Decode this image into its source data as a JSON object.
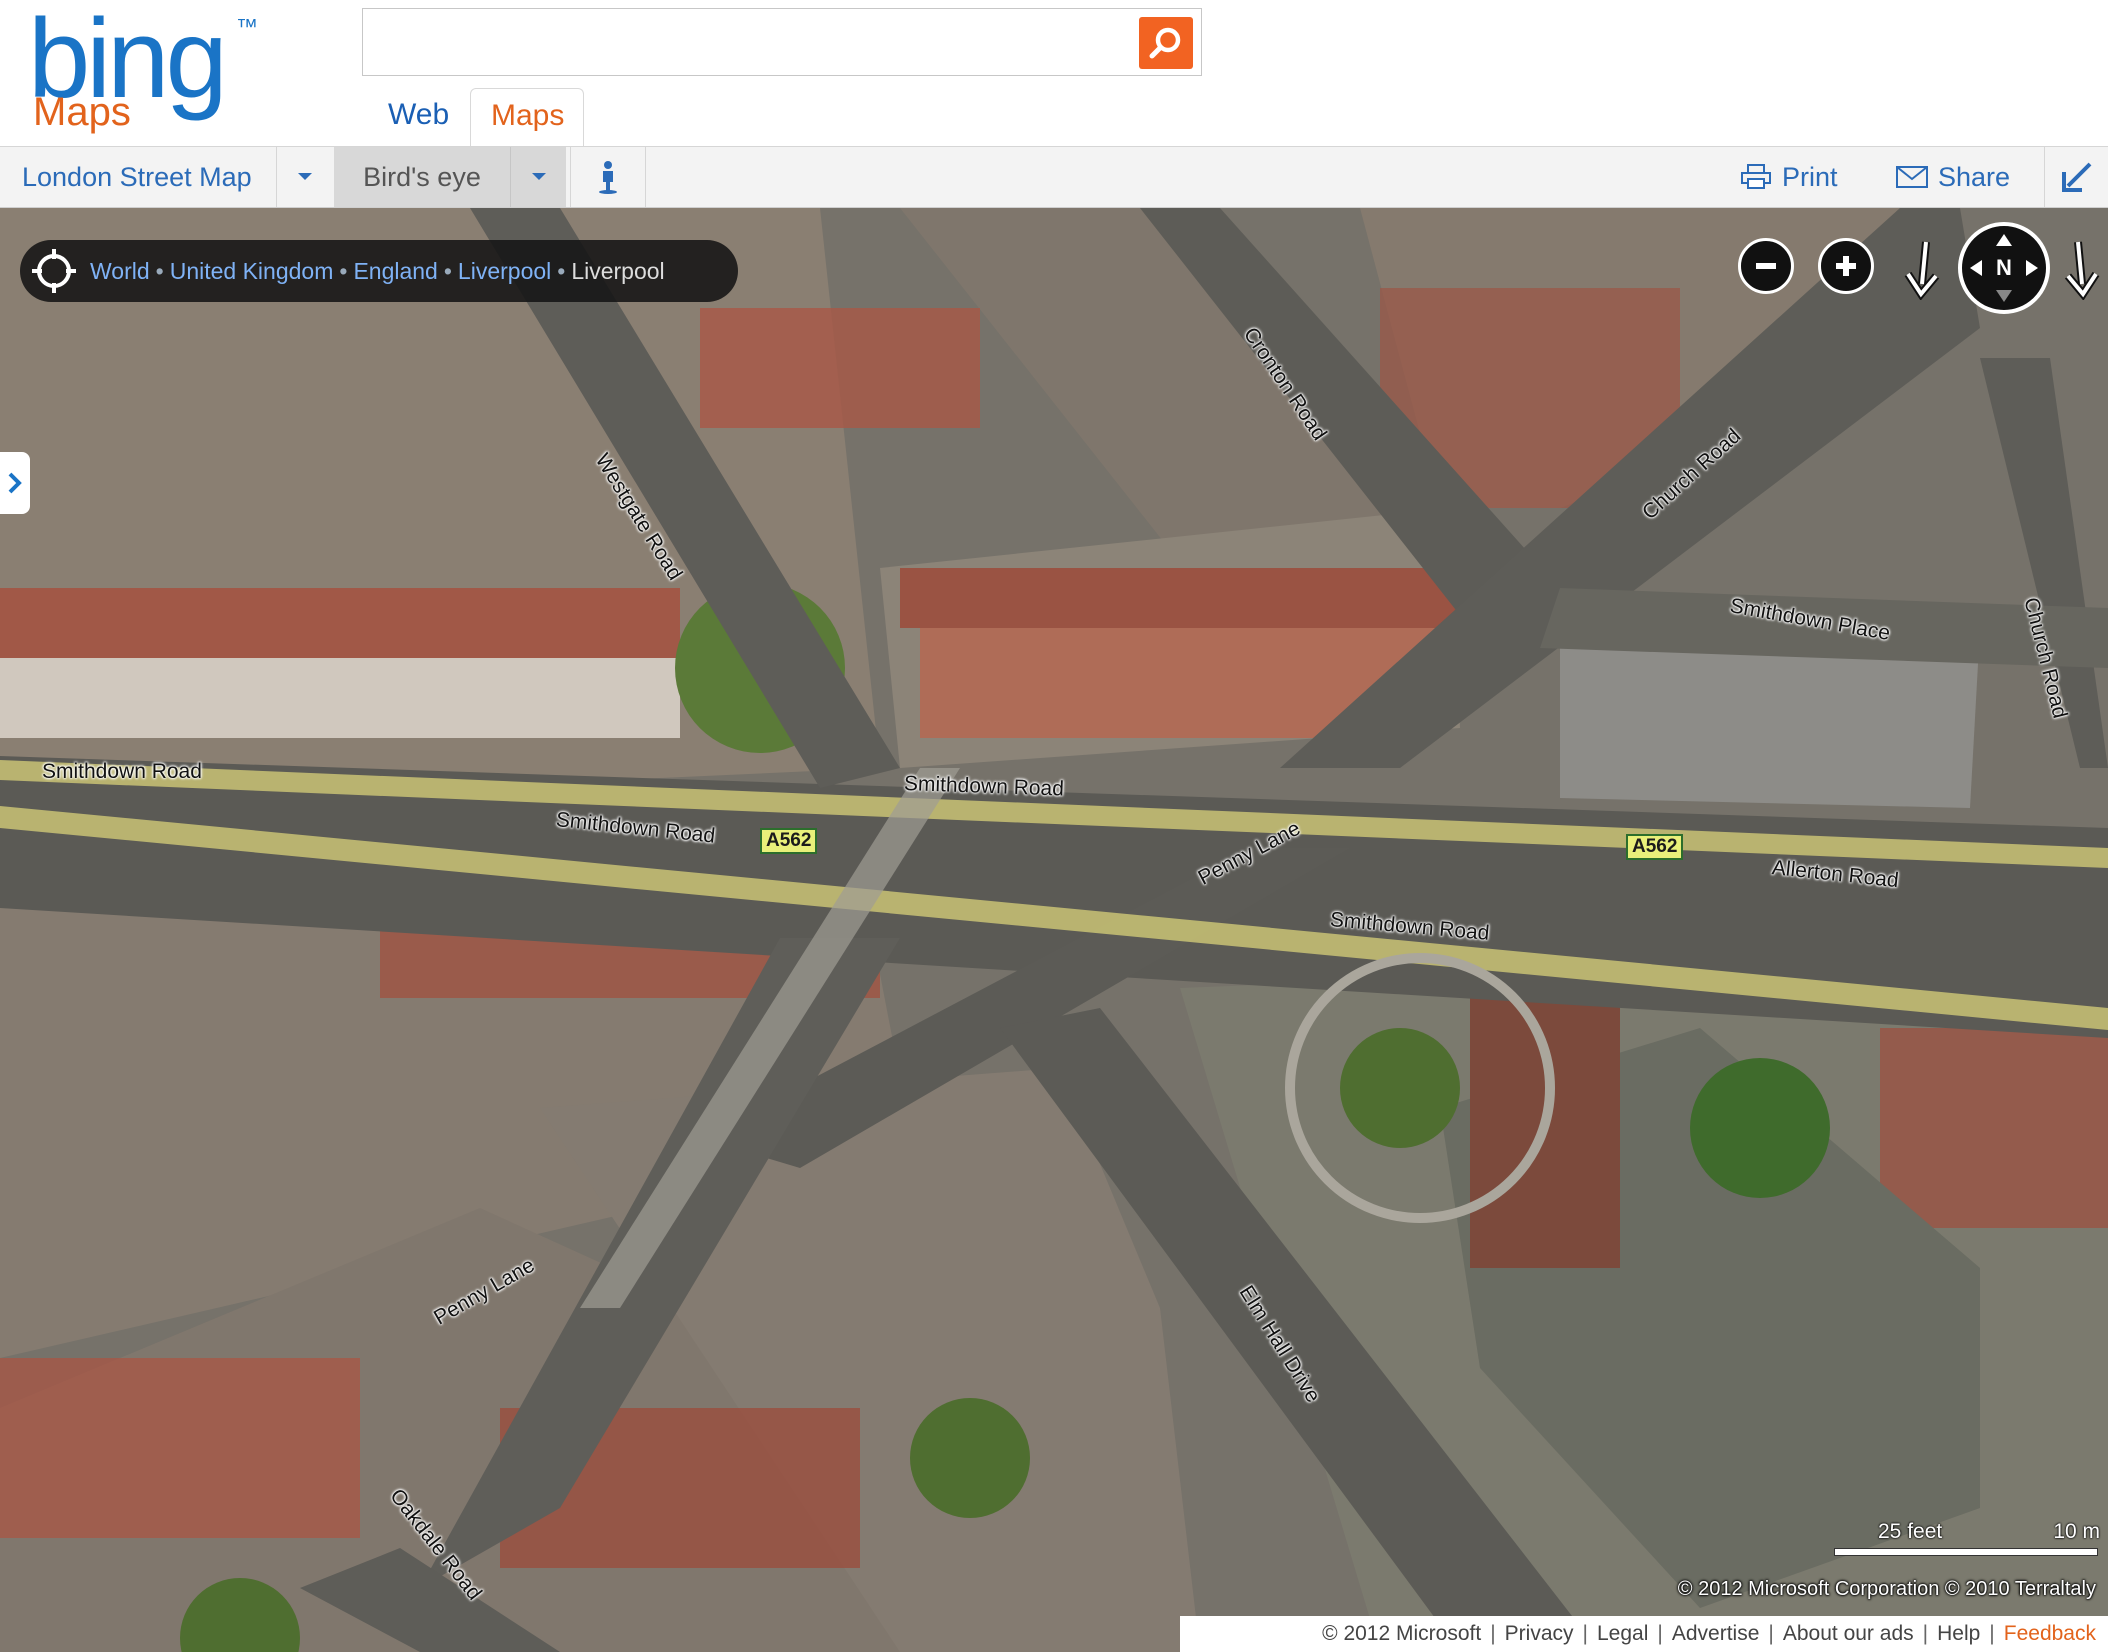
{
  "brand": {
    "logo": "bing",
    "logo_mark": "™",
    "product": "Maps"
  },
  "search": {
    "value": "",
    "placeholder": "",
    "button_icon": "search-icon"
  },
  "tabs": [
    {
      "label": "Web"
    },
    {
      "label": "Maps"
    }
  ],
  "toolbar": {
    "map_style": "London Street Map",
    "view_mode": "Bird's eye",
    "streetside_icon": "person-icon",
    "print_label": "Print",
    "share_label": "Share",
    "collapse_icon": "arrow-collapse-icon"
  },
  "breadcrumb": {
    "items": [
      "World",
      "United Kingdom",
      "England",
      "Liverpool"
    ],
    "current": "Liverpool"
  },
  "nav": {
    "compass_label": "N"
  },
  "roads": {
    "smithdown_1": "Smithdown Road",
    "smithdown_2": "Smithdown Road",
    "smithdown_3": "Smithdown Road",
    "smithdown_4": "Smithdown Road",
    "westgate": "Westgate Road",
    "cronton": "Cronton Road",
    "church_road": "Church Road",
    "church_road_2": "Church Road",
    "smithdown_place": "Smithdown Place",
    "penny_lane": "Penny Lane",
    "penny_lane_2": "Penny Lane",
    "allerton": "Allerton Road",
    "elm_hall": "Elm Hall Drive",
    "oakdale": "Oakdale Road",
    "shield_1": "A562",
    "shield_2": "A562"
  },
  "scale": {
    "feet": "25 feet",
    "meters": "10 m"
  },
  "copyright": "© 2012 Microsoft Corporation   © 2010 Terraltaly",
  "footer": {
    "copyright": "© 2012 Microsoft",
    "links": [
      "Privacy",
      "Legal",
      "Advertise",
      "About our ads",
      "Help"
    ],
    "feedback": "Feedback"
  },
  "colors": {
    "accent_blue": "#1a74c6",
    "accent_orange": "#e2631c",
    "road_highlight": "#d8d27a"
  }
}
